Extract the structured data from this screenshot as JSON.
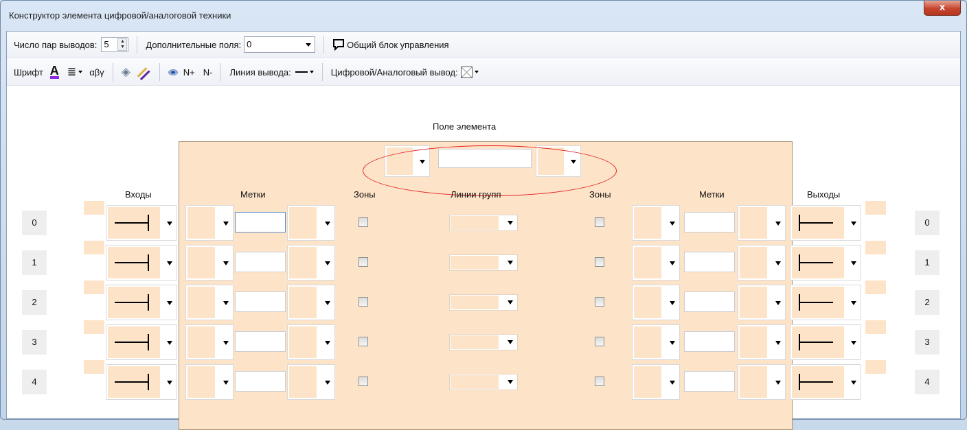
{
  "window": {
    "title": "Конструктор элемента цифровой/аналоговой техники",
    "close_label": "x"
  },
  "toolbar1": {
    "pairs_label": "Число пар выводов:",
    "pairs_value": "5",
    "extra_fields_label": "Дополнительные поля:",
    "extra_fields_value": "0",
    "common_block_label": "Общий блок управления"
  },
  "toolbar2": {
    "font_label": "Шрифт",
    "font_color_icon": "A",
    "greek_label": "αβγ",
    "n_plus": "N+",
    "n_minus": "N-",
    "line_label": "Линия вывода:",
    "digital_label": "Цифровой/Аналоговый вывод:"
  },
  "element_field": {
    "label": "Поле элемента"
  },
  "headers": {
    "inputs": "Входы",
    "marks_left": "Метки",
    "zones_left": "Зоны",
    "group_lines": "Линии групп",
    "zones_right": "Зоны",
    "marks_right": "Метки",
    "outputs": "Выходы"
  },
  "rows": [
    {
      "left": "0",
      "right": "0"
    },
    {
      "left": "1",
      "right": "1"
    },
    {
      "left": "2",
      "right": "2"
    },
    {
      "left": "3",
      "right": "3"
    },
    {
      "left": "4",
      "right": "4"
    }
  ]
}
